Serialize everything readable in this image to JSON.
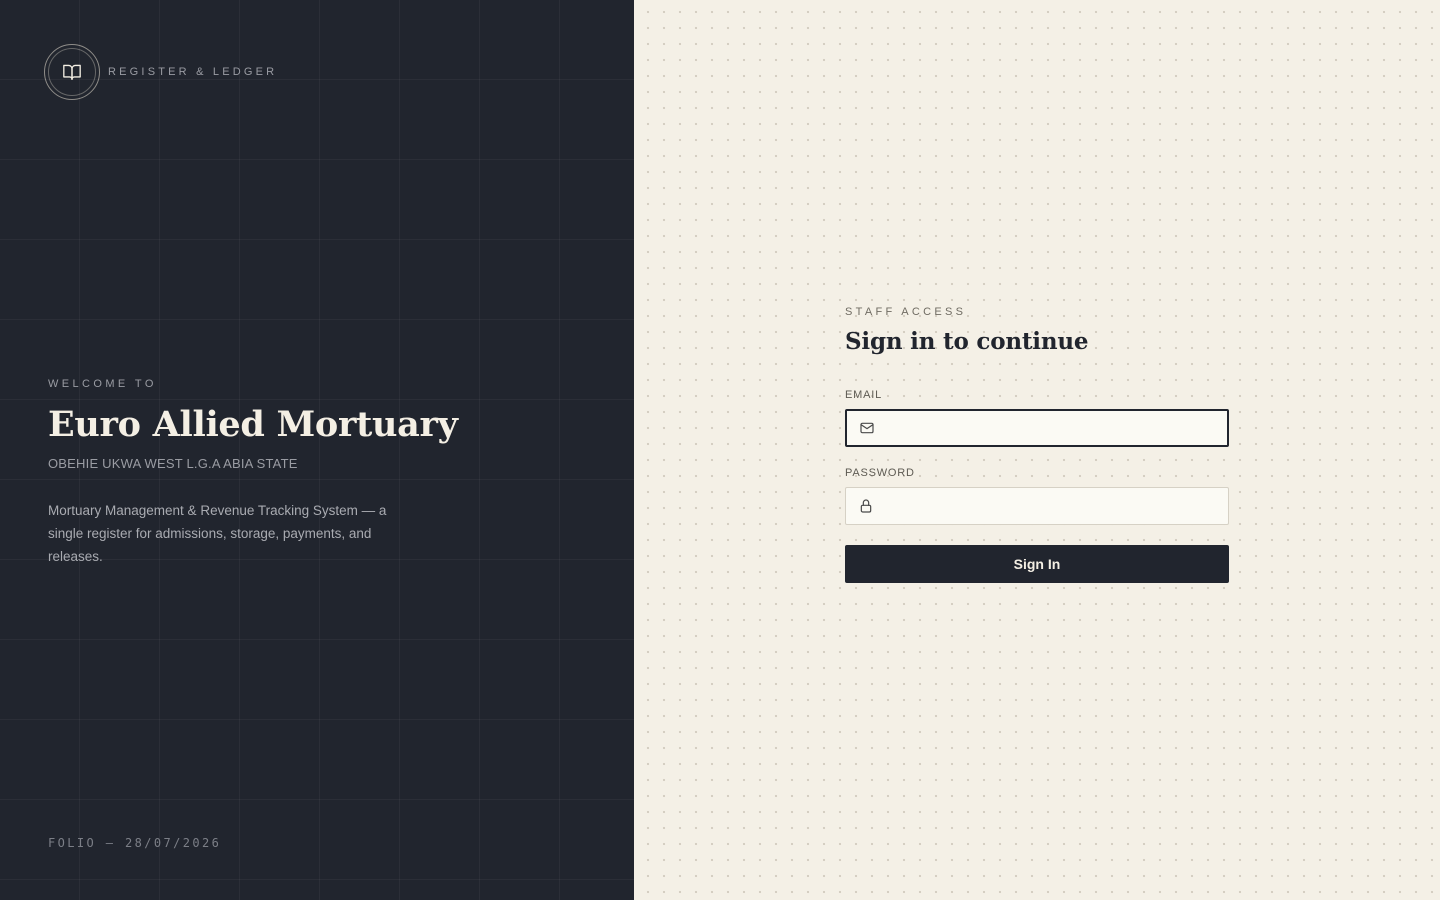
{
  "brand": {
    "label": "REGISTER & LEDGER",
    "icon": "open-book-icon"
  },
  "hero": {
    "welcome": "WELCOME TO",
    "title": "Euro Allied Mortuary",
    "location": "OBEHIE UKWA WEST L.G.A ABIA STATE",
    "description": "Mortuary Management & Revenue Tracking System — a single register for admissions, storage, payments, and releases."
  },
  "folio": "FOLIO — 28/07/2026",
  "form": {
    "eyebrow": "STAFF ACCESS",
    "title": "Sign in to continue",
    "email": {
      "label": "EMAIL",
      "value": "",
      "placeholder": "",
      "icon": "mail-icon"
    },
    "password": {
      "label": "PASSWORD",
      "value": "",
      "placeholder": "",
      "icon": "lock-icon"
    },
    "submit_label": "Sign In"
  },
  "colors": {
    "dark_panel": "#21252e",
    "cream_panel": "#f4f0e6",
    "input_bg": "#fbfaf4",
    "accent_text": "#f4efe4"
  }
}
